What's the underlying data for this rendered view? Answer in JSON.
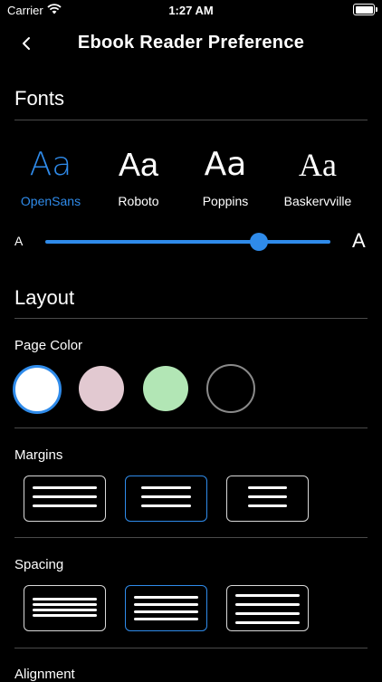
{
  "status": {
    "carrier": "Carrier",
    "time": "1:27 AM"
  },
  "header": {
    "title": "Ebook Reader Preference"
  },
  "fonts": {
    "title": "Fonts",
    "options": [
      {
        "sample": "Aa",
        "name": "OpenSans",
        "selected": true
      },
      {
        "sample": "Aa",
        "name": "Roboto",
        "selected": false
      },
      {
        "sample": "Aa",
        "name": "Poppins",
        "selected": false
      },
      {
        "sample": "Aa",
        "name": "Baskervville",
        "selected": false
      }
    ],
    "size_slider": {
      "min_label": "A",
      "max_label": "A",
      "value": 0.75
    }
  },
  "layout": {
    "title": "Layout",
    "page_color": {
      "label": "Page Color",
      "options": [
        "#ffffff",
        "#e2c9d1",
        "#b2e6b5",
        "#000000"
      ],
      "selected_index": 0
    },
    "margins": {
      "label": "Margins",
      "options": [
        "wide",
        "medium",
        "narrow"
      ],
      "selected_index": 1
    },
    "spacing": {
      "label": "Spacing",
      "options": [
        "tight",
        "normal",
        "loose"
      ],
      "selected_index": 1
    },
    "alignment": {
      "label": "Alignment"
    }
  },
  "colors": {
    "accent": "#2f8bea",
    "background": "#000000"
  }
}
